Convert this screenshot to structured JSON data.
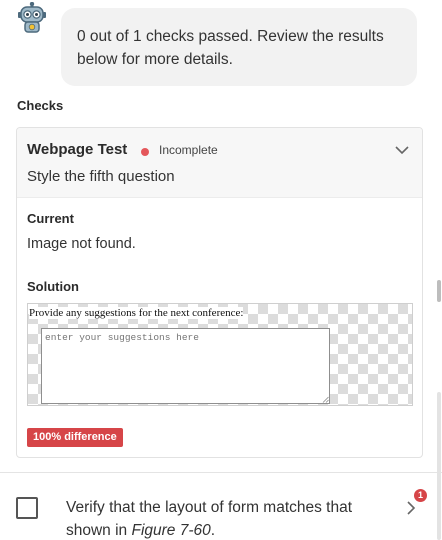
{
  "chat": {
    "message": "0 out of 1 checks passed. Review the results below for more details.",
    "avatar_icon": "robot-icon"
  },
  "checks": {
    "heading": "Checks",
    "items": [
      {
        "name": "Webpage Test",
        "status": "Incomplete",
        "status_color": "#e4575b",
        "question": "Style the fifth question",
        "current_label": "Current",
        "current_value": "Image not found.",
        "solution_label": "Solution",
        "solution_form": {
          "prompt": "Provide any suggestions for the next conference:",
          "placeholder": "enter your suggestions here"
        },
        "difference": "100% difference",
        "difference_color": "#d64548"
      }
    ]
  },
  "task": {
    "text_before": "Verify that the layout of form matches that shown in ",
    "text_italic": "Figure 7-60",
    "text_after": ".",
    "badge_count": "1",
    "badge_color": "#d64548"
  }
}
